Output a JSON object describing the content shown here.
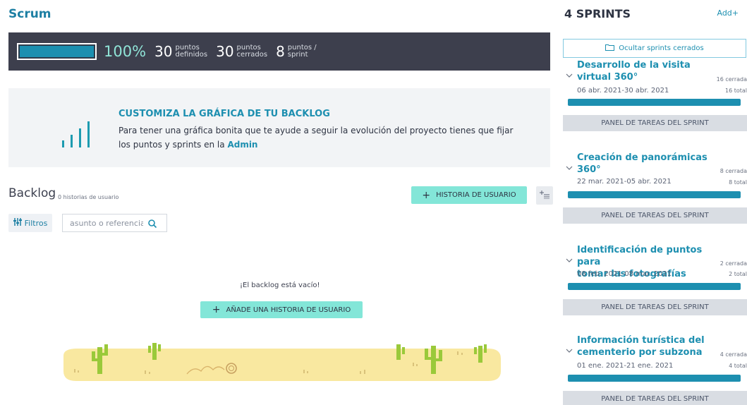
{
  "project": {
    "title": "Scrum"
  },
  "summary": {
    "progress_pct": 100,
    "progress_label": "100%",
    "defined_points": "30",
    "defined_label_1": "puntos",
    "defined_label_2": "definidos",
    "closed_points": "30",
    "closed_label_1": "puntos",
    "closed_label_2": "cerrados",
    "per_sprint_points": "8",
    "per_sprint_label_1": "puntos /",
    "per_sprint_label_2": "sprint"
  },
  "promo": {
    "title": "CUSTOMIZA LA GRÁFICA DE TU BACKLOG",
    "text": "Para tener una gráfica bonita que te ayude a seguir la evolución del proyecto tienes que fijar los puntos y sprints en la",
    "link": "Admin"
  },
  "backlog": {
    "title": "Backlog",
    "count": "0 historias de usuario",
    "add_story": "HISTORIA DE USUARIO",
    "filters": "Filtros",
    "search_placeholder": "asunto o referencia",
    "empty_text": "¡El backlog está vacío!",
    "add_story_empty": "AÑADE UNA HISTORIA DE USUARIO"
  },
  "sidebar": {
    "title": "4 SPRINTS",
    "add": "Add",
    "hide_closed": "Ocultar sprints cerrados",
    "sprints": [
      {
        "name_1": "Desarrollo de la visita",
        "name_2": "virtual 360°",
        "dates": "06 abr. 2021-30 abr. 2021",
        "closed": "16 cerrada",
        "total": "16 total",
        "panel": "PANEL DE TAREAS DEL SPRINT"
      },
      {
        "name_1": "Creación de panorámicas",
        "name_2": "360°",
        "dates": "22 mar. 2021-05 abr. 2021",
        "closed": "8 cerrada",
        "total": "8 total",
        "panel": "PANEL DE TAREAS DEL SPRINT"
      },
      {
        "name_1": "Identificación de puntos para",
        "name_2": "tomar las fotografías",
        "dates": "08 feb. 2021-08 mar. 2021",
        "closed": "2 cerrada",
        "total": "2 total",
        "panel": "PANEL DE TAREAS DEL SPRINT"
      },
      {
        "name_1": "Información turística del",
        "name_2": "cementerio por subzona",
        "dates": "01 ene. 2021-21 ene. 2021",
        "closed": "4 cerrada",
        "total": "4 total",
        "panel": "PANEL DE TAREAS DEL SPRINT"
      }
    ]
  },
  "colors": {
    "accent": "#1d8fb0",
    "mint": "#83e6d8",
    "dark_bar": "#3d3f4d"
  }
}
